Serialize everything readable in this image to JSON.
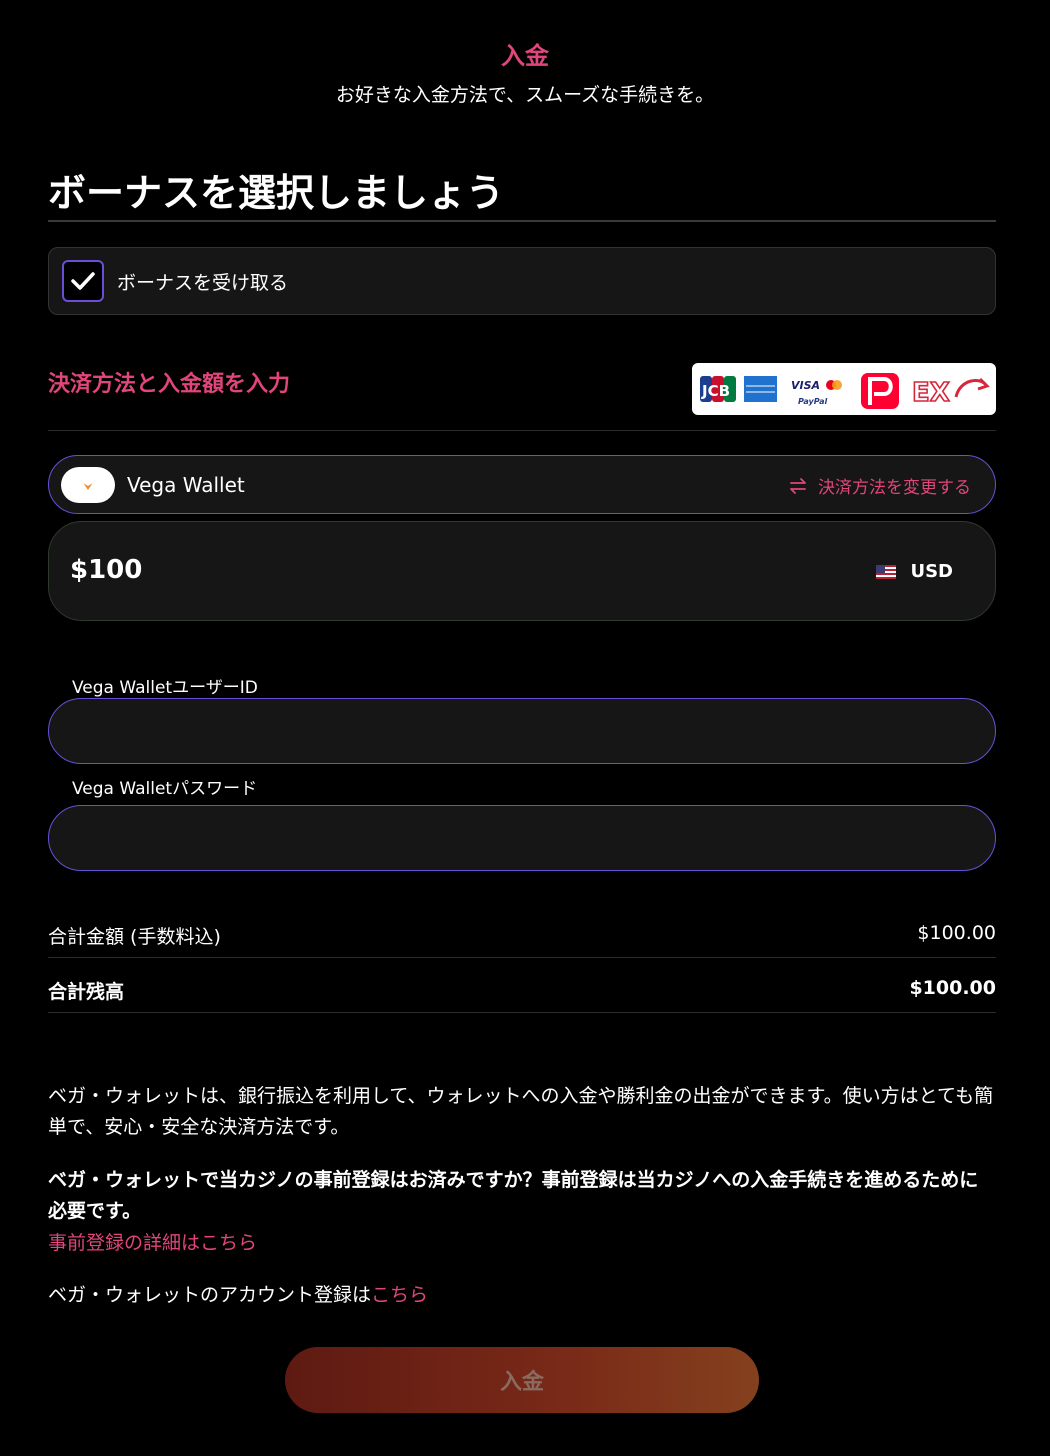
{
  "header": {
    "title": "入金",
    "subtitle": "お好きな入金方法で、スムーズな手続きを。"
  },
  "bonus": {
    "heading": "ボーナスを選択しましょう",
    "checkbox_label": "ボーナスを受け取る",
    "checked": true
  },
  "payment": {
    "heading": "決済方法と入金額を入力",
    "logos": [
      "JCB",
      "AMERICAN EXPRESS",
      "VISA",
      "mastercard",
      "PayPal",
      "PayPay",
      "EXS"
    ],
    "method_name": "Vega Wallet",
    "change_label": "決済方法を変更する",
    "amount": "$100",
    "currency": "USD"
  },
  "fields": {
    "user_id_label": "Vega WalletユーザーID",
    "user_id_value": "",
    "password_label": "Vega Walletパスワード",
    "password_value": ""
  },
  "summary": {
    "total_label": "合計金額 (手数料込)",
    "total_value": "$100.00",
    "balance_label": "合計残高",
    "balance_value": "$100.00"
  },
  "info": {
    "paragraph1": "ベガ・ウォレットは、銀行振込を利用して、ウォレットへの入金や勝利金の出金ができます。使い方はとても簡単で、安心・安全な決済方法です。",
    "paragraph2": "ベガ・ウォレットで当カジノの事前登録はお済みですか？事前登録は当カジノへの入金手続きを進めるために必要です。",
    "details_link": "事前登録の詳細はこちら",
    "account_text": "ベガ・ウォレットのアカウント登録は",
    "account_link": "こちら"
  },
  "submit_label": "入金",
  "colors": {
    "accent": "#e0457b",
    "input_border": "#6a4fd6",
    "background": "#000000",
    "panel": "#161616"
  }
}
